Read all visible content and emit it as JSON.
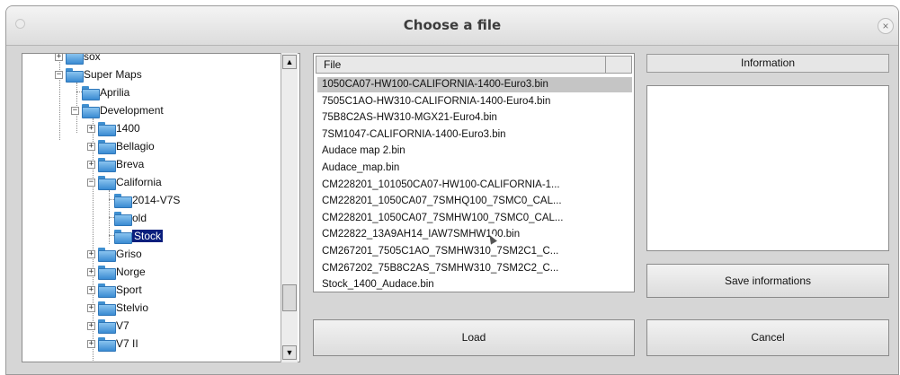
{
  "window": {
    "title": "Choose a file",
    "close_glyph": "×"
  },
  "tree": {
    "nodes": [
      {
        "label": "sox",
        "expander": "+"
      },
      {
        "label": "Super Maps",
        "expander": "−"
      },
      {
        "label": "Aprilia",
        "expander": ""
      },
      {
        "label": "Development",
        "expander": "−"
      },
      {
        "label": "1400",
        "expander": "+"
      },
      {
        "label": "Bellagio",
        "expander": "+"
      },
      {
        "label": "Breva",
        "expander": "+"
      },
      {
        "label": "California",
        "expander": "−"
      },
      {
        "label": "2014-V7S",
        "expander": ""
      },
      {
        "label": "old",
        "expander": ""
      },
      {
        "label": "Stock",
        "expander": "",
        "selected": true
      },
      {
        "label": "Griso",
        "expander": "+"
      },
      {
        "label": "Norge",
        "expander": "+"
      },
      {
        "label": "Sport",
        "expander": "+"
      },
      {
        "label": "Stelvio",
        "expander": "+"
      },
      {
        "label": "V7",
        "expander": "+"
      },
      {
        "label": "V7 II",
        "expander": "+"
      }
    ],
    "scroll_up_glyph": "▲",
    "scroll_down_glyph": "▼"
  },
  "files": {
    "column_header": "File",
    "items": [
      "1050CA07-HW100-CALIFORNIA-1400-Euro3.bin",
      "7505C1AO-HW310-CALIFORNIA-1400-Euro4.bin",
      "75B8C2AS-HW310-MGX21-Euro4.bin",
      "7SM1047-CALIFORNIA-1400-Euro3.bin",
      "Audace map 2.bin",
      "Audace_map.bin",
      "CM228201_101050CA07-HW100-CALIFORNIA-1...",
      "CM228201_1050CA07_7SMHQ100_7SMC0_CAL...",
      "CM228201_1050CA07_7SMHW100_7SMC0_CAL...",
      "CM22822_13A9AH14_IAW7SMHW100.bin",
      "CM267201_7505C1AO_7SMHW310_7SM2C1_C...",
      "CM267202_75B8C2AS_7SMHW310_7SM2C2_C...",
      "Stock_1400_Audace.bin"
    ],
    "selected_index": 0
  },
  "information": {
    "header": "Information",
    "content": ""
  },
  "buttons": {
    "save": "Save informations",
    "load": "Load",
    "cancel": "Cancel"
  },
  "icons": {
    "folder": "folder-icon",
    "close": "close-icon",
    "cursor": "mouse-pointer-icon"
  }
}
